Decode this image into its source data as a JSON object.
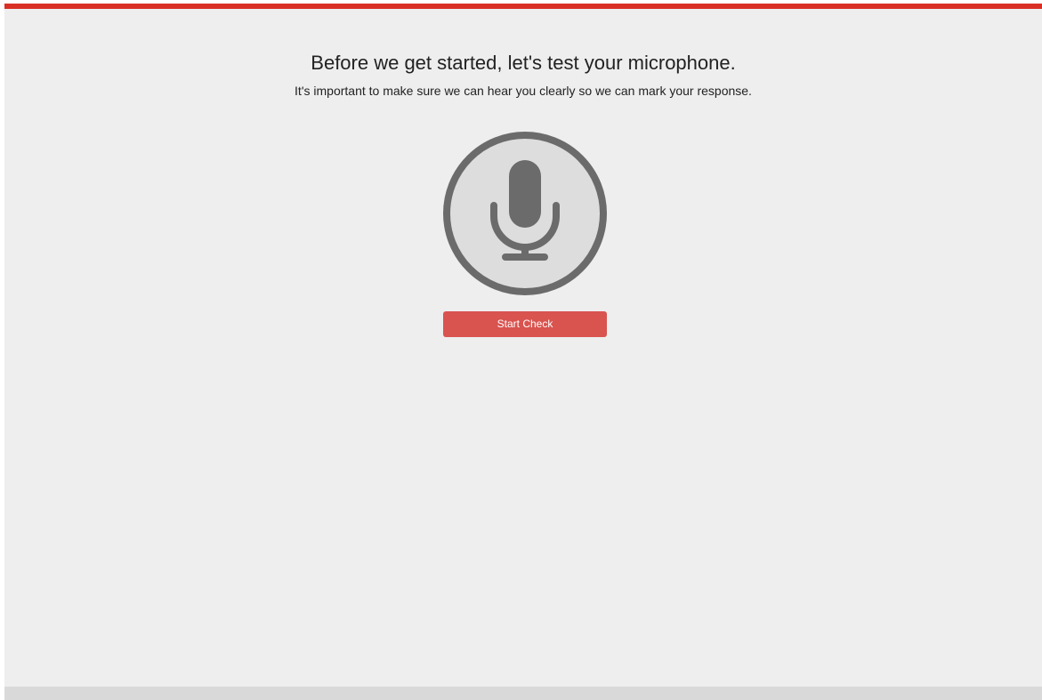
{
  "header": {
    "title": "Before we get started, let's test your microphone.",
    "subtitle": "It's important to make sure we can hear you clearly so we can mark your response."
  },
  "mic": {
    "icon": "microphone-icon"
  },
  "actions": {
    "start_label": "Start Check"
  },
  "colors": {
    "accent_bar": "#d93025",
    "button": "#d9534f",
    "icon": "#6b6b6b",
    "icon_fill": "#dddddd",
    "page_bg": "#eeeeee"
  }
}
